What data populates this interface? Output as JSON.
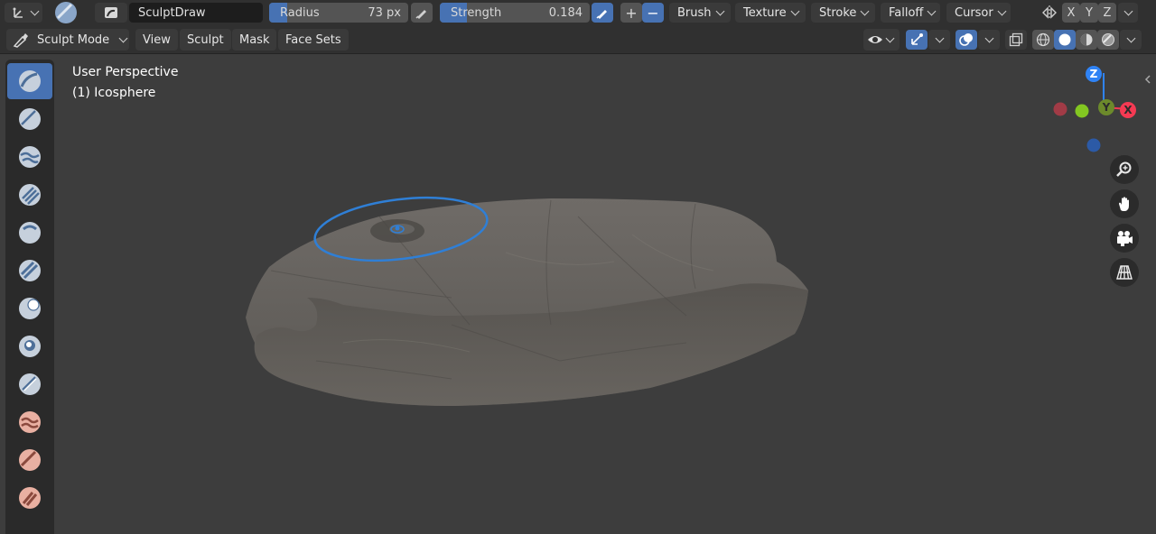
{
  "tool_header": {
    "brush_name": "SculptDraw",
    "radius": {
      "label": "Radius",
      "value": "73 px"
    },
    "strength": {
      "label": "Strength",
      "value": "0.184",
      "fill_fraction": 0.184
    },
    "add_symbol": "+",
    "subtract_symbol": "−",
    "menus": [
      "Brush",
      "Texture",
      "Stroke",
      "Falloff",
      "Cursor"
    ],
    "symmetry_axes": [
      "X",
      "Y",
      "Z"
    ]
  },
  "header": {
    "mode": "Sculpt Mode",
    "menus": [
      "View",
      "Sculpt",
      "Mask",
      "Face Sets"
    ]
  },
  "viewport": {
    "perspective": "User Perspective",
    "object": "(1) Icosphere"
  },
  "gizmo": {
    "z": "Z",
    "y": "Y",
    "x": "X",
    "colors": {
      "x": "#f53a53",
      "y": "#83c721",
      "z": "#2f83f5"
    }
  },
  "colors": {
    "accent": "#4772b3",
    "brush_cursor": "#2f7fd6"
  },
  "toolbar_icons": [
    "draw-brush-icon",
    "draw-sharp-brush-icon",
    "clay-brush-icon",
    "clay-strips-brush-icon",
    "clay-thumb-brush-icon",
    "layer-brush-icon",
    "inflate-brush-icon",
    "blob-brush-icon",
    "crease-brush-icon",
    "smooth-brush-icon",
    "flatten-brush-icon",
    "fill-brush-icon"
  ]
}
